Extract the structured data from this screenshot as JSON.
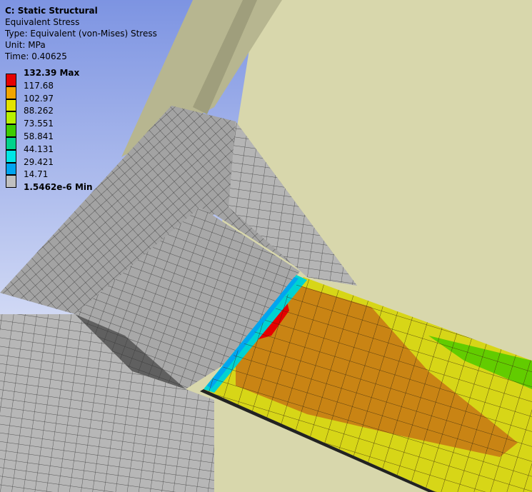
{
  "header": {
    "title": "C: Static Structural",
    "result": "Equivalent Stress",
    "type": "Type: Equivalent (von-Mises) Stress",
    "unit": "Unit: MPa",
    "time": "Time: 0.40625"
  },
  "legend": {
    "labels": [
      "132.39 Max",
      "117.68",
      "102.97",
      "88.262",
      "73.551",
      "58.841",
      "44.131",
      "29.421",
      "14.71",
      "1.5462e-6 Min"
    ],
    "colors": [
      "#e60000",
      "#f2a500",
      "#e3e300",
      "#b8f000",
      "#3ecc00",
      "#00d28c",
      "#00e6e6",
      "#00a5f0",
      "#c0c0c0"
    ]
  },
  "model": {
    "background_top": "#7d94e2",
    "background_bottom": "#ffffff",
    "frame_color": "#d8d7ac",
    "mesh_color": "#9a9a9a",
    "plate_fill": "#c98414"
  }
}
